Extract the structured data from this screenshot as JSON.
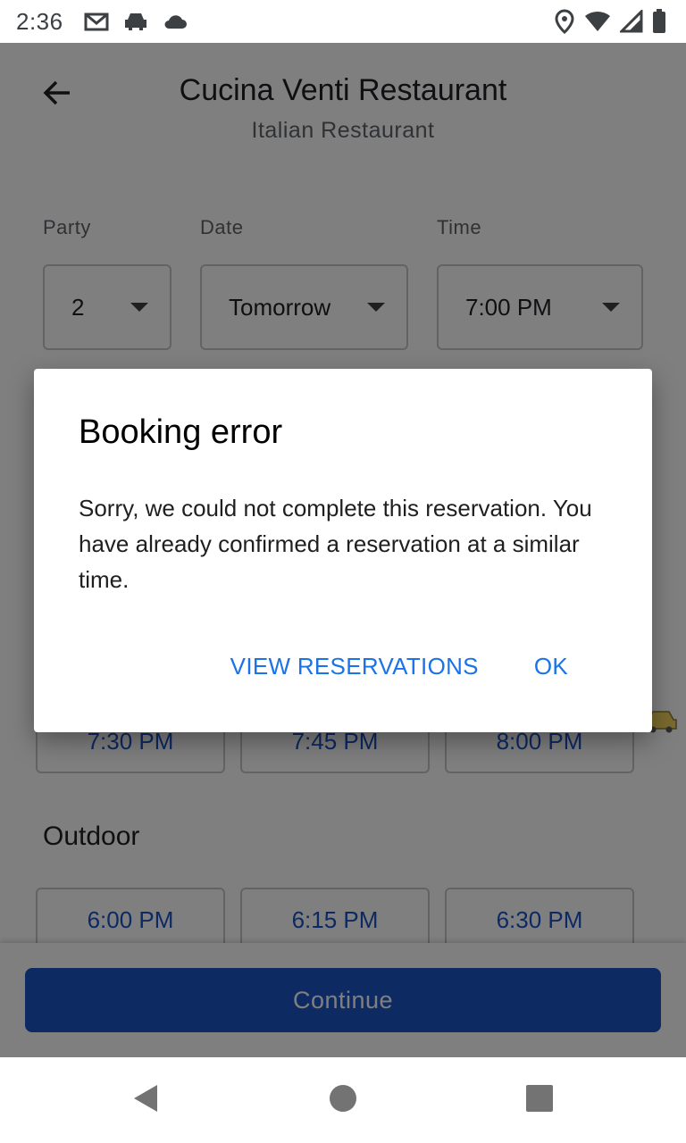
{
  "status_bar": {
    "time": "2:36",
    "left_icons": [
      "gmail-icon",
      "car-icon",
      "cloud-icon"
    ],
    "right_icons": [
      "location-icon",
      "wifi-icon",
      "signal-icon",
      "battery-icon"
    ]
  },
  "header": {
    "title": "Cucina Venti Restaurant",
    "subtitle": "Italian Restaurant"
  },
  "filters": {
    "party": {
      "label": "Party",
      "value": "2"
    },
    "date": {
      "label": "Date",
      "value": "Tomorrow"
    },
    "time": {
      "label": "Time",
      "value": "7:00 PM"
    }
  },
  "indoor_slots": [
    "7:30 PM",
    "7:45 PM",
    "8:00 PM"
  ],
  "outdoor": {
    "title": "Outdoor",
    "slots": [
      "6:00 PM",
      "6:15 PM",
      "6:30 PM"
    ]
  },
  "footer": {
    "continue_label": "Continue"
  },
  "dialog": {
    "title": "Booking error",
    "body": "Sorry, we could not complete this reservation. You have already confirmed a reservation at a similar time.",
    "secondary_action": "VIEW RESERVATIONS",
    "primary_action": "OK"
  },
  "colors": {
    "accent_blue": "#1a73e8",
    "slot_text": "#1a53c6",
    "continue_button": "#1a56c4"
  }
}
